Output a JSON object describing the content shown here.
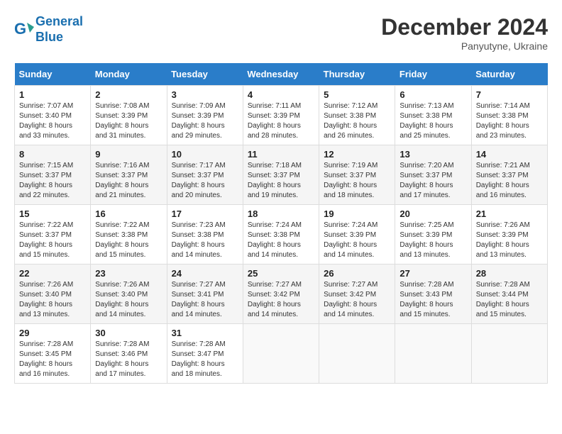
{
  "header": {
    "logo_line1": "General",
    "logo_line2": "Blue",
    "month": "December 2024",
    "location": "Panyutyne, Ukraine"
  },
  "days_of_week": [
    "Sunday",
    "Monday",
    "Tuesday",
    "Wednesday",
    "Thursday",
    "Friday",
    "Saturday"
  ],
  "weeks": [
    [
      {
        "day": "1",
        "sunrise": "Sunrise: 7:07 AM",
        "sunset": "Sunset: 3:40 PM",
        "daylight": "Daylight: 8 hours and 33 minutes."
      },
      {
        "day": "2",
        "sunrise": "Sunrise: 7:08 AM",
        "sunset": "Sunset: 3:39 PM",
        "daylight": "Daylight: 8 hours and 31 minutes."
      },
      {
        "day": "3",
        "sunrise": "Sunrise: 7:09 AM",
        "sunset": "Sunset: 3:39 PM",
        "daylight": "Daylight: 8 hours and 29 minutes."
      },
      {
        "day": "4",
        "sunrise": "Sunrise: 7:11 AM",
        "sunset": "Sunset: 3:39 PM",
        "daylight": "Daylight: 8 hours and 28 minutes."
      },
      {
        "day": "5",
        "sunrise": "Sunrise: 7:12 AM",
        "sunset": "Sunset: 3:38 PM",
        "daylight": "Daylight: 8 hours and 26 minutes."
      },
      {
        "day": "6",
        "sunrise": "Sunrise: 7:13 AM",
        "sunset": "Sunset: 3:38 PM",
        "daylight": "Daylight: 8 hours and 25 minutes."
      },
      {
        "day": "7",
        "sunrise": "Sunrise: 7:14 AM",
        "sunset": "Sunset: 3:38 PM",
        "daylight": "Daylight: 8 hours and 23 minutes."
      }
    ],
    [
      {
        "day": "8",
        "sunrise": "Sunrise: 7:15 AM",
        "sunset": "Sunset: 3:37 PM",
        "daylight": "Daylight: 8 hours and 22 minutes."
      },
      {
        "day": "9",
        "sunrise": "Sunrise: 7:16 AM",
        "sunset": "Sunset: 3:37 PM",
        "daylight": "Daylight: 8 hours and 21 minutes."
      },
      {
        "day": "10",
        "sunrise": "Sunrise: 7:17 AM",
        "sunset": "Sunset: 3:37 PM",
        "daylight": "Daylight: 8 hours and 20 minutes."
      },
      {
        "day": "11",
        "sunrise": "Sunrise: 7:18 AM",
        "sunset": "Sunset: 3:37 PM",
        "daylight": "Daylight: 8 hours and 19 minutes."
      },
      {
        "day": "12",
        "sunrise": "Sunrise: 7:19 AM",
        "sunset": "Sunset: 3:37 PM",
        "daylight": "Daylight: 8 hours and 18 minutes."
      },
      {
        "day": "13",
        "sunrise": "Sunrise: 7:20 AM",
        "sunset": "Sunset: 3:37 PM",
        "daylight": "Daylight: 8 hours and 17 minutes."
      },
      {
        "day": "14",
        "sunrise": "Sunrise: 7:21 AM",
        "sunset": "Sunset: 3:37 PM",
        "daylight": "Daylight: 8 hours and 16 minutes."
      }
    ],
    [
      {
        "day": "15",
        "sunrise": "Sunrise: 7:22 AM",
        "sunset": "Sunset: 3:37 PM",
        "daylight": "Daylight: 8 hours and 15 minutes."
      },
      {
        "day": "16",
        "sunrise": "Sunrise: 7:22 AM",
        "sunset": "Sunset: 3:38 PM",
        "daylight": "Daylight: 8 hours and 15 minutes."
      },
      {
        "day": "17",
        "sunrise": "Sunrise: 7:23 AM",
        "sunset": "Sunset: 3:38 PM",
        "daylight": "Daylight: 8 hours and 14 minutes."
      },
      {
        "day": "18",
        "sunrise": "Sunrise: 7:24 AM",
        "sunset": "Sunset: 3:38 PM",
        "daylight": "Daylight: 8 hours and 14 minutes."
      },
      {
        "day": "19",
        "sunrise": "Sunrise: 7:24 AM",
        "sunset": "Sunset: 3:39 PM",
        "daylight": "Daylight: 8 hours and 14 minutes."
      },
      {
        "day": "20",
        "sunrise": "Sunrise: 7:25 AM",
        "sunset": "Sunset: 3:39 PM",
        "daylight": "Daylight: 8 hours and 13 minutes."
      },
      {
        "day": "21",
        "sunrise": "Sunrise: 7:26 AM",
        "sunset": "Sunset: 3:39 PM",
        "daylight": "Daylight: 8 hours and 13 minutes."
      }
    ],
    [
      {
        "day": "22",
        "sunrise": "Sunrise: 7:26 AM",
        "sunset": "Sunset: 3:40 PM",
        "daylight": "Daylight: 8 hours and 13 minutes."
      },
      {
        "day": "23",
        "sunrise": "Sunrise: 7:26 AM",
        "sunset": "Sunset: 3:40 PM",
        "daylight": "Daylight: 8 hours and 14 minutes."
      },
      {
        "day": "24",
        "sunrise": "Sunrise: 7:27 AM",
        "sunset": "Sunset: 3:41 PM",
        "daylight": "Daylight: 8 hours and 14 minutes."
      },
      {
        "day": "25",
        "sunrise": "Sunrise: 7:27 AM",
        "sunset": "Sunset: 3:42 PM",
        "daylight": "Daylight: 8 hours and 14 minutes."
      },
      {
        "day": "26",
        "sunrise": "Sunrise: 7:27 AM",
        "sunset": "Sunset: 3:42 PM",
        "daylight": "Daylight: 8 hours and 14 minutes."
      },
      {
        "day": "27",
        "sunrise": "Sunrise: 7:28 AM",
        "sunset": "Sunset: 3:43 PM",
        "daylight": "Daylight: 8 hours and 15 minutes."
      },
      {
        "day": "28",
        "sunrise": "Sunrise: 7:28 AM",
        "sunset": "Sunset: 3:44 PM",
        "daylight": "Daylight: 8 hours and 15 minutes."
      }
    ],
    [
      {
        "day": "29",
        "sunrise": "Sunrise: 7:28 AM",
        "sunset": "Sunset: 3:45 PM",
        "daylight": "Daylight: 8 hours and 16 minutes."
      },
      {
        "day": "30",
        "sunrise": "Sunrise: 7:28 AM",
        "sunset": "Sunset: 3:46 PM",
        "daylight": "Daylight: 8 hours and 17 minutes."
      },
      {
        "day": "31",
        "sunrise": "Sunrise: 7:28 AM",
        "sunset": "Sunset: 3:47 PM",
        "daylight": "Daylight: 8 hours and 18 minutes."
      },
      null,
      null,
      null,
      null
    ]
  ]
}
